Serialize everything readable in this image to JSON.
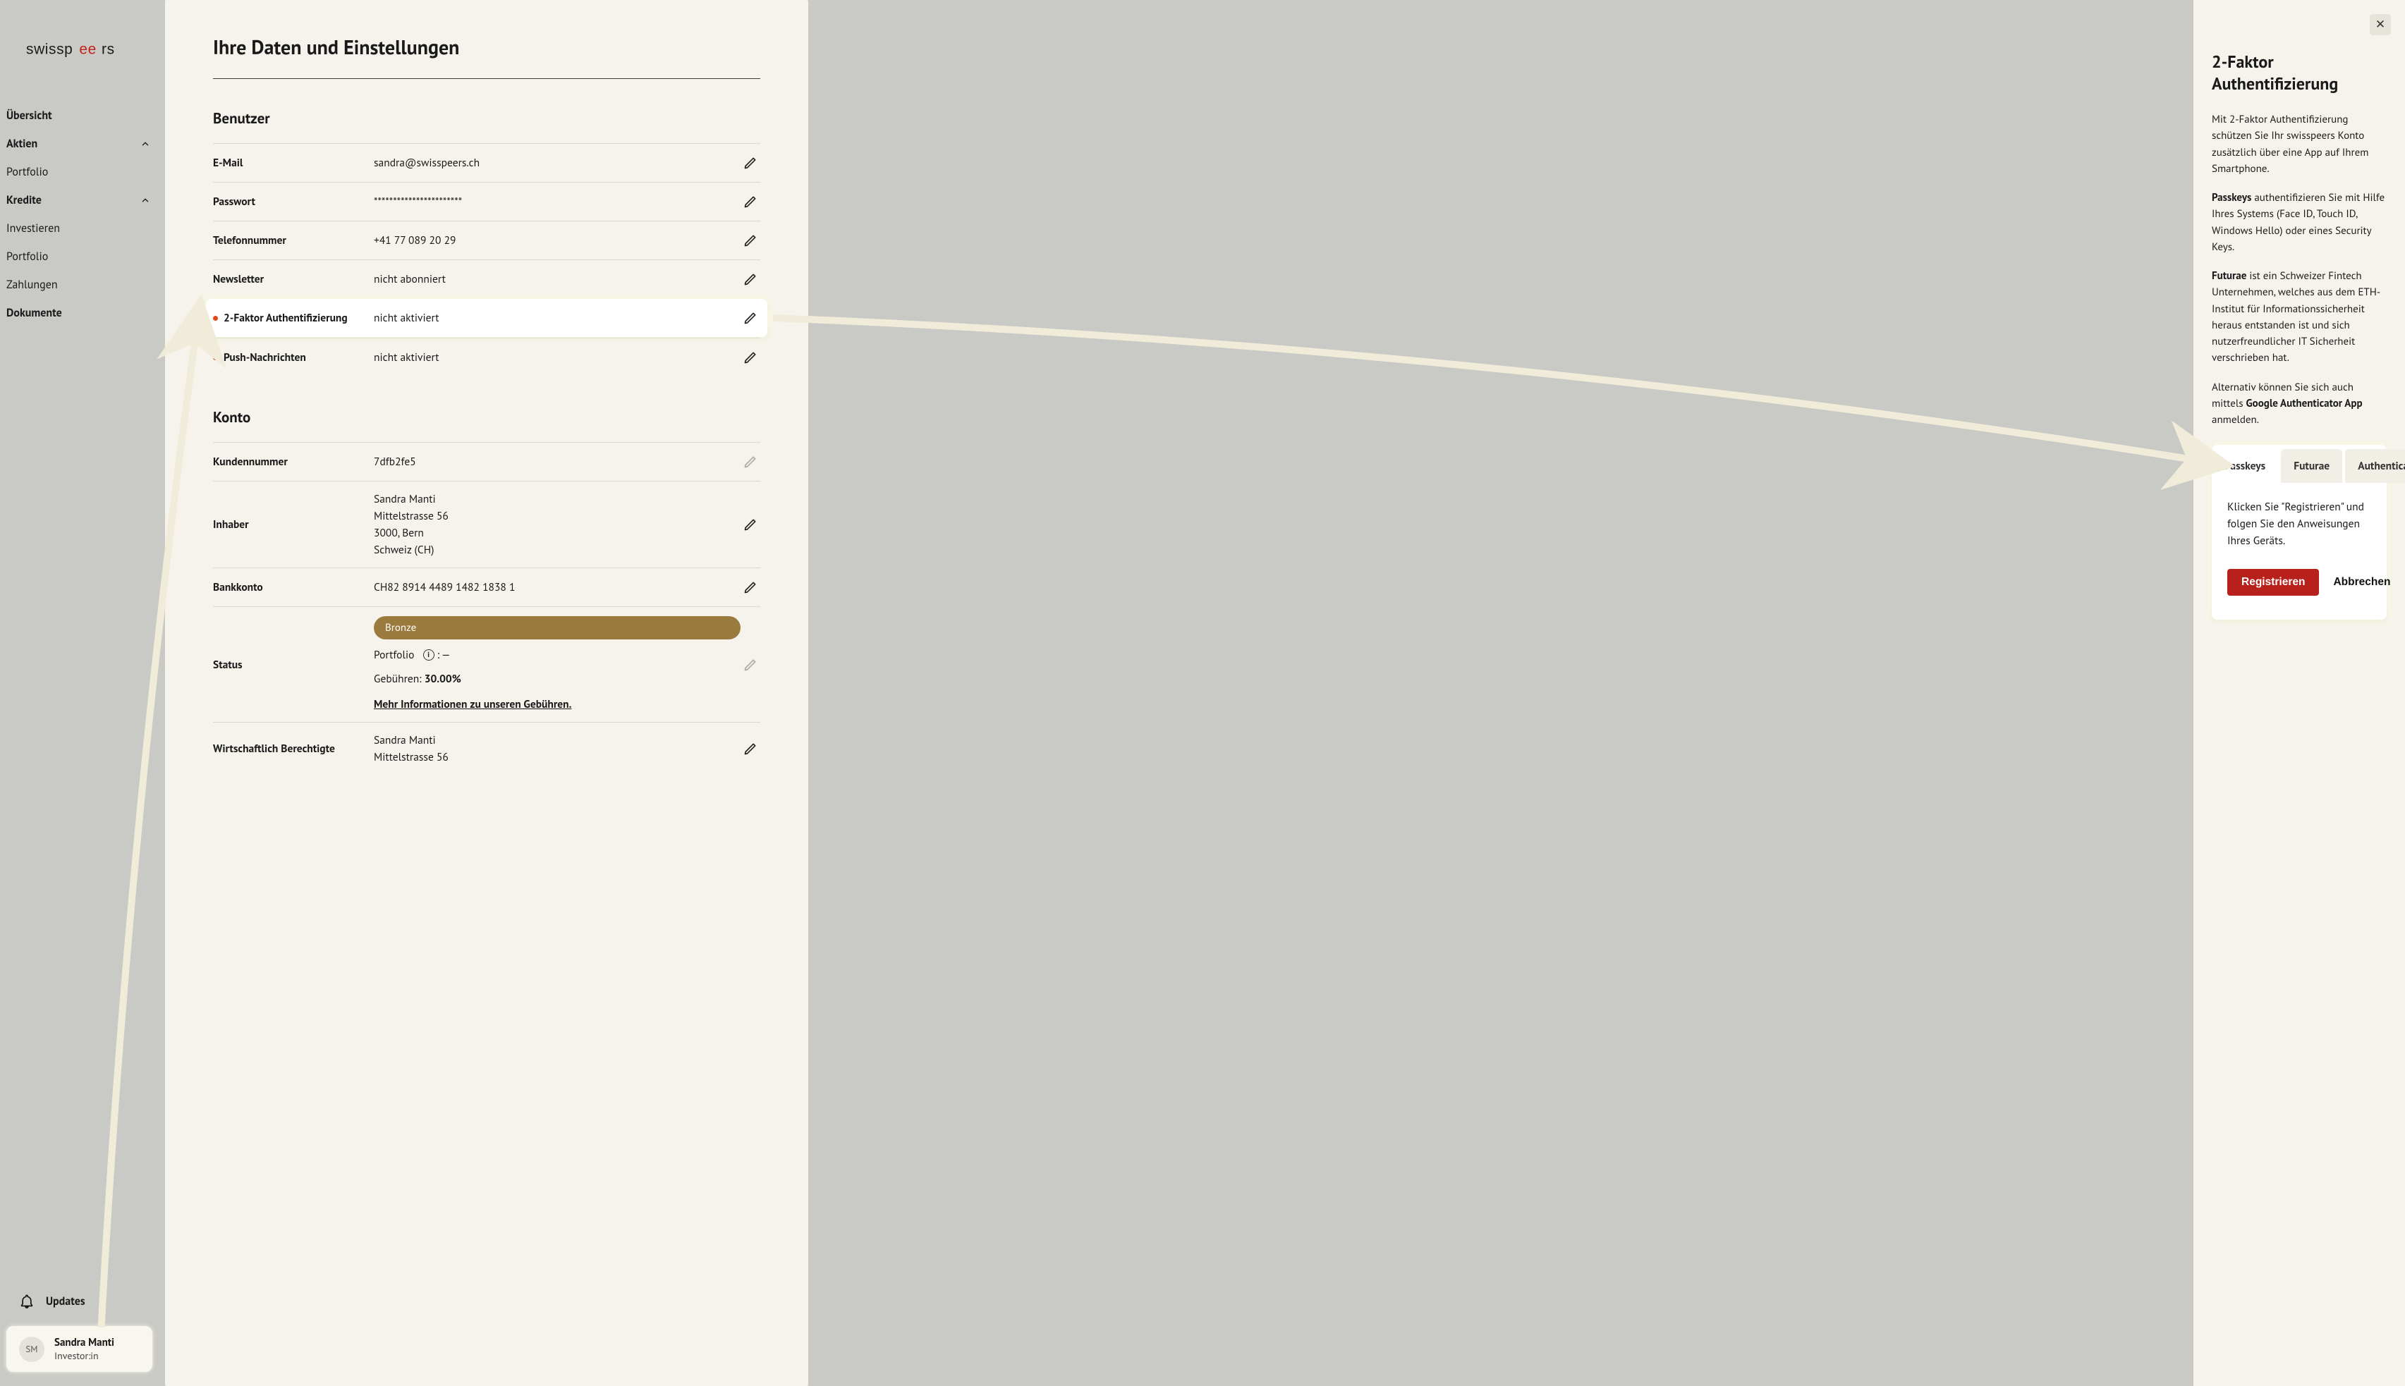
{
  "brand": {
    "name": "swisspeers"
  },
  "sidebar": {
    "items": {
      "overview": "Übersicht",
      "shares": "Aktien",
      "portfolio1": "Portfolio",
      "credits": "Kredite",
      "invest": "Investieren",
      "portfolio2": "Portfolio",
      "payments": "Zahlungen",
      "documents": "Dokumente"
    },
    "updates_label": "Updates"
  },
  "user": {
    "initials": "SM",
    "name": "Sandra Manti",
    "role": "Investor:in"
  },
  "page": {
    "title": "Ihre Daten und Einstellungen",
    "section_user_title": "Benutzer",
    "section_account_title": "Konto"
  },
  "user_data": {
    "email": {
      "label": "E-Mail",
      "value": "sandra@swisspeers.ch"
    },
    "password": {
      "label": "Passwort",
      "value": "***********************"
    },
    "phone": {
      "label": "Telefonnummer",
      "value": "+41 77 089 20 29"
    },
    "newsletter": {
      "label": "Newsletter",
      "value": "nicht abonniert"
    },
    "twofa": {
      "label": "2-Faktor Authentifizierung",
      "value": "nicht aktiviert"
    },
    "push": {
      "label": "Push-Nachrichten",
      "value": "nicht aktiviert"
    }
  },
  "account_data": {
    "customer_no": {
      "label": "Kundennummer",
      "value": "7dfb2fe5"
    },
    "owner": {
      "label": "Inhaber",
      "lines": {
        "name": "Sandra Manti",
        "street": "Mittelstrasse 56",
        "city": "3000, Bern",
        "country": "Schweiz (CH)"
      }
    },
    "bank": {
      "label": "Bankkonto",
      "value": "CH82 8914 4489 1482 1838 1"
    },
    "status": {
      "label": "Status",
      "tier": "Bronze",
      "portfolio_prefix": "Portfolio",
      "portfolio_suffix": " : —",
      "fees_prefix": "Gebühren: ",
      "fees_value": "30.00%",
      "fees_link": "Mehr Informationen zu unseren Gebühren."
    },
    "beneficial": {
      "label": "Wirtschaftlich Berechtigte",
      "lines": {
        "name": "Sandra Manti",
        "street": "Mittelstrasse 56"
      }
    }
  },
  "drawer": {
    "title": "2-Faktor Authentifizierung",
    "p1": "Mit 2-Faktor Authentifizierung schützen Sie Ihr swisspeers Konto zusätzlich über eine App auf Ihrem Smartphone.",
    "p2_strong": "Passkeys",
    "p2_rest": " authentifizieren Sie mit Hilfe Ihres Systems (Face ID, Touch ID, Windows Hello) oder eines Security Keys.",
    "p3_strong": "Futurae",
    "p3_rest": " ist ein Schweizer Fintech Unternehmen, welches aus dem ETH-Institut für Informationssicherheit heraus entstanden ist und sich nutzerfreundlicher IT Sicherheit verschrieben hat.",
    "p4_pre": "Alternativ können Sie sich auch mittels ",
    "p4_strong": "Google Authenticator App",
    "p4_post": " anmelden.",
    "tabs": {
      "passkeys": "Passkeys",
      "futurae": "Futurae",
      "authenticator": "Authenticator"
    },
    "tab_body": "Klicken Sie \"Registrieren\" und folgen Sie den Anweisungen Ihres Geräts.",
    "btn_register": "Registrieren",
    "btn_cancel": "Abbrechen"
  }
}
